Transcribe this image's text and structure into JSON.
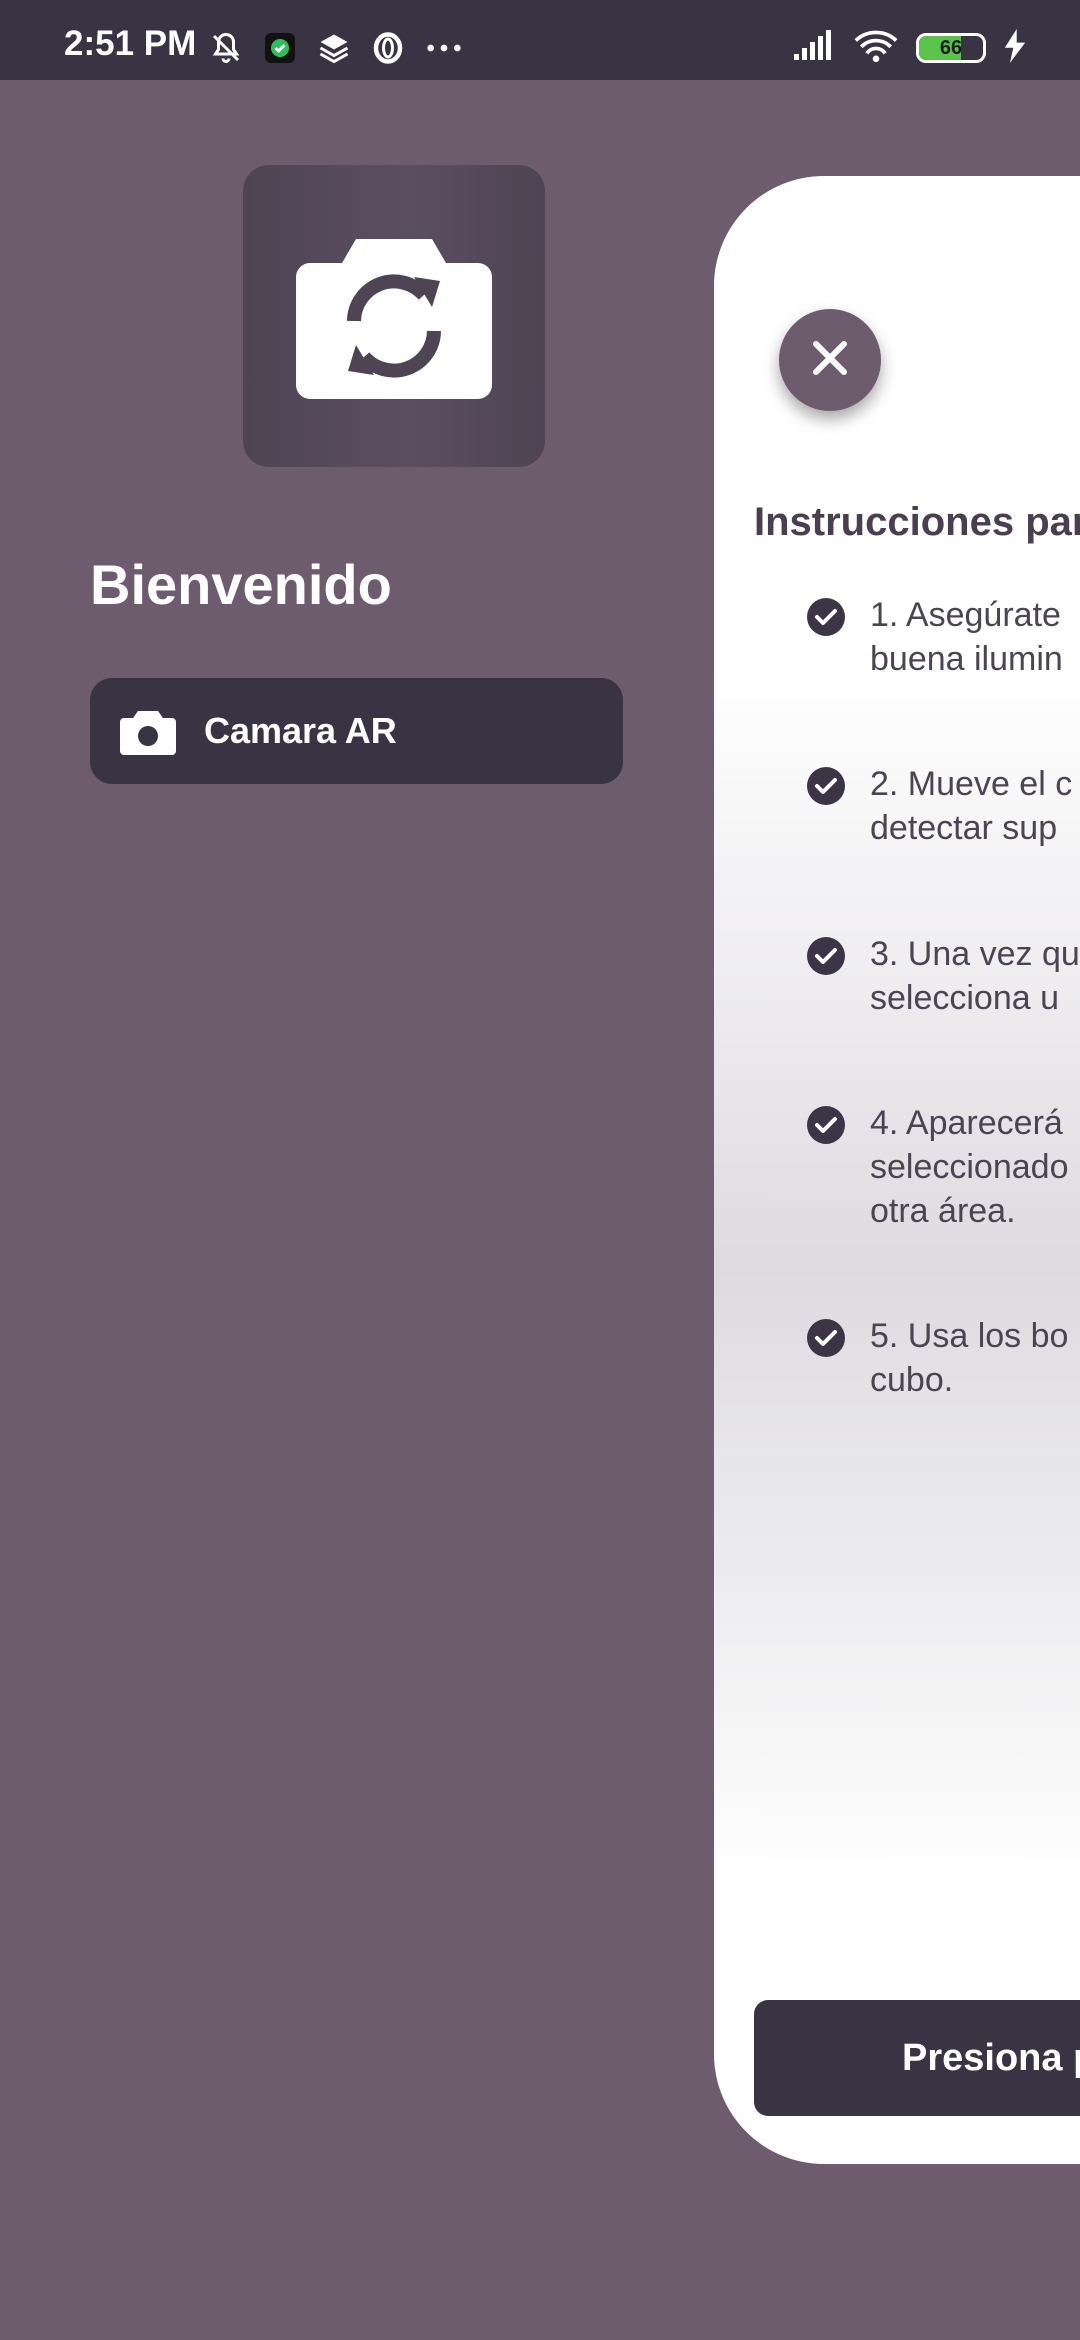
{
  "status_bar": {
    "time": "2:51 PM",
    "battery_level": "66",
    "battery_fraction": 0.66,
    "icons_left": [
      "notifications-off-icon",
      "security-app-icon",
      "layers-icon",
      "opera-icon",
      "more-icon"
    ],
    "icons_right": [
      "signal-icon",
      "wifi-icon",
      "battery-icon",
      "charging-icon"
    ]
  },
  "home": {
    "logo_icon": "camera-switch-icon",
    "welcome_title": "Bienvenido",
    "camera_button_label": "Camara AR",
    "camera_button_icon": "camera-icon"
  },
  "sheet": {
    "close_icon": "close-icon",
    "title": "Instrucciones par",
    "steps": [
      {
        "text": "1. Asegúrate\nbuena ilumin"
      },
      {
        "text": "2. Mueve el c\ndetectar sup"
      },
      {
        "text": "3. Una vez qu\nselecciona u"
      },
      {
        "text": "4. Aparecerá\nseleccionado\notra área."
      },
      {
        "text": "5. Usa los bo\ncubo."
      }
    ],
    "button_label": "Presiona p"
  },
  "colors": {
    "background": "#6d5c6e",
    "dark": "#383444",
    "sheet": "#ffffff",
    "battery_green": "#5bc24a"
  }
}
